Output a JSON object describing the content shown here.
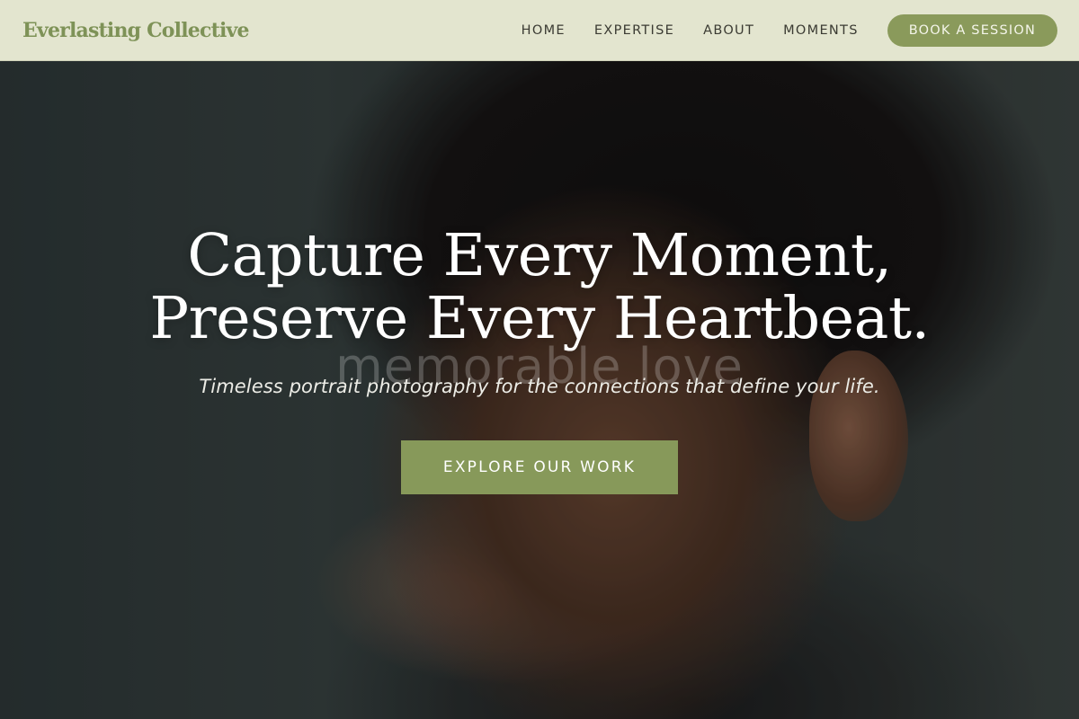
{
  "brand": {
    "name": "Everlasting Collective"
  },
  "nav": {
    "links": [
      {
        "label": "HOME"
      },
      {
        "label": "EXPERTISE"
      },
      {
        "label": "ABOUT"
      },
      {
        "label": "MOMENTS"
      }
    ],
    "cta_label": "BOOK A SESSION"
  },
  "hero": {
    "title_line_1": "Capture Every Moment,",
    "title_line_2": "Preserve Every Heartbeat.",
    "watermark": "memorable love",
    "subtitle": "Timeless portrait photography for the connections that define your life.",
    "cta_label": "EXPLORE OUR WORK"
  },
  "colors": {
    "nav_background": "#e3e5cf",
    "brand": "#7e9257",
    "accent_green": "#8a9a5b",
    "hero_text": "#ffffff"
  }
}
